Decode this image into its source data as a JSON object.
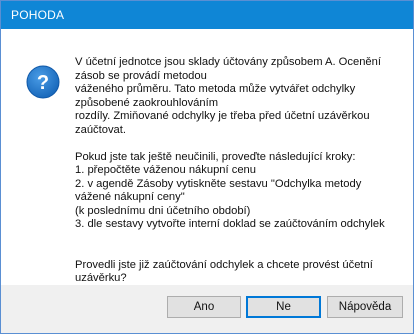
{
  "window": {
    "title": "POHODA"
  },
  "icon": {
    "name": "question-icon",
    "glyph": "?",
    "color": "#1e74c8"
  },
  "message": {
    "lines": [
      "V účetní jednotce jsou sklady účtovány způsobem A. Ocenění",
      "zásob se provádí metodou",
      "váženého průměru. Tato metoda může vytvářet odchylky",
      "způsobené zaokrouhlováním",
      "rozdíly. Zmiňované odchylky je třeba před účetní uzávěrkou",
      "zaúčtovat.",
      "",
      "Pokud jste tak ještě neučinili, proveďte následující kroky:",
      "1. přepočtěte váženou nákupní cenu",
      "2. v agendě Zásoby vytiskněte sestavu \"Odchylka metody",
      "vážené nákupní ceny\"",
      "     (k poslednímu dni účetního období)",
      "3. dle sestavy vytvořte interní doklad se zaúčtováním odchylek",
      "",
      "",
      "Provedli jste již zaúčtování odchylek a chcete provést účetní",
      "uzávěrku?"
    ]
  },
  "buttons": {
    "yes": "Ano",
    "no": "Ne",
    "help": "Nápověda"
  }
}
